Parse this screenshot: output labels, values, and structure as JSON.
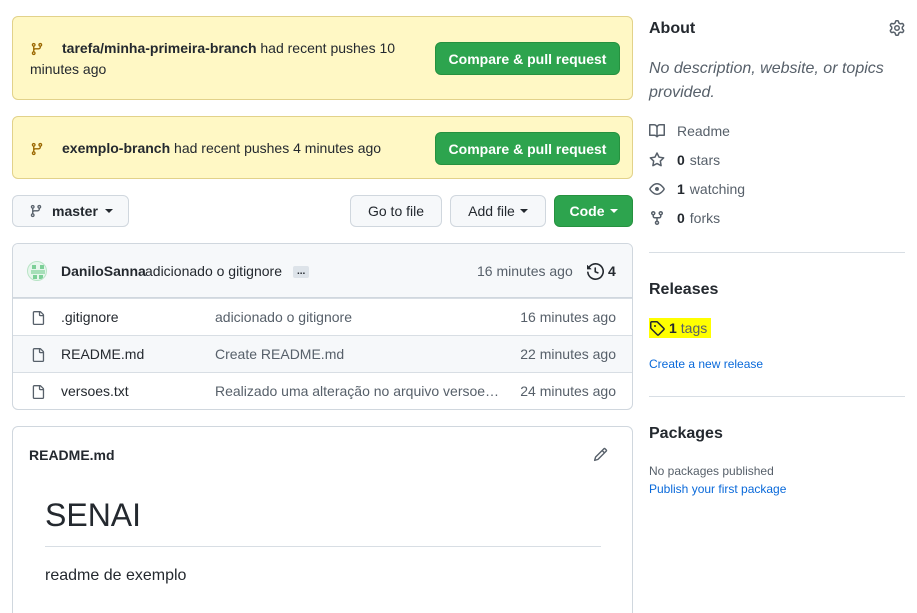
{
  "banners": [
    {
      "branch": "tarefa/minha-primeira-branch",
      "suffix": " had recent pushes 10",
      "suffix2": "minutes ago",
      "button": "Compare & pull request"
    },
    {
      "branch": "exemplo-branch",
      "suffix": " had recent pushes 4 minutes ago",
      "button": "Compare & pull request"
    }
  ],
  "toolbar": {
    "branch": "master",
    "go_to_file": "Go to file",
    "add_file": "Add file",
    "code": "Code"
  },
  "commit": {
    "author": "DaniloSanna",
    "message": "adicionado o gitignore",
    "ellipsis": "...",
    "age": "16 minutes ago",
    "count": "4"
  },
  "files": [
    {
      "name": ".gitignore",
      "message": "adicionado o gitignore",
      "age": "16 minutes ago"
    },
    {
      "name": "README.md",
      "message": "Create README.md",
      "age": "22 minutes ago"
    },
    {
      "name": "versoes.txt",
      "message": "Realizado uma alteração no arquivo versoes.txt",
      "age": "24 minutes ago"
    }
  ],
  "readme": {
    "filename": "README.md",
    "heading": "SENAI",
    "body": "readme de exemplo"
  },
  "about": {
    "title": "About",
    "description": "No description, website, or topics provided.",
    "readme": "Readme",
    "stars_count": "0",
    "stars_label": "stars",
    "watching_count": "1",
    "watching_label": "watching",
    "forks_count": "0",
    "forks_label": "forks"
  },
  "releases": {
    "title": "Releases",
    "tags_count": "1",
    "tags_label": "tags",
    "create_link": "Create a new release",
    "highlight_color": "#ffff00"
  },
  "packages": {
    "title": "Packages",
    "none_text": "No packages published",
    "publish_link": "Publish your first package"
  },
  "colors": {
    "accent_green": "#2da44e",
    "banner_bg": "#fff8c5",
    "link": "#0969da"
  }
}
